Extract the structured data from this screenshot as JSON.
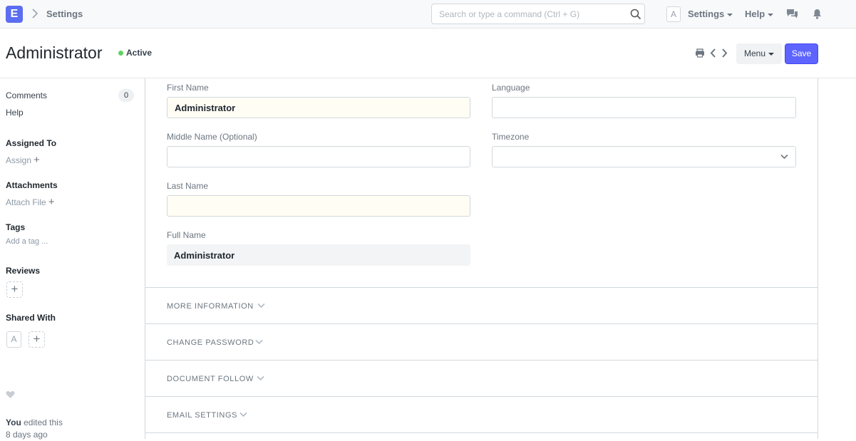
{
  "navbar": {
    "logo_letter": "E",
    "breadcrumb": "Settings",
    "search_placeholder": "Search or type a command (Ctrl + G)",
    "avatar_letter": "A",
    "settings_label": "Settings",
    "help_label": "Help"
  },
  "header": {
    "title": "Administrator",
    "status": "Active",
    "menu_label": "Menu",
    "save_label": "Save"
  },
  "sidebar": {
    "comments_label": "Comments",
    "comments_count": "0",
    "help_label": "Help",
    "assigned_to_label": "Assigned To",
    "assign_label": "Assign",
    "attachments_label": "Attachments",
    "attach_file_label": "Attach File",
    "tags_label": "Tags",
    "add_tag_label": "Add a tag ...",
    "reviews_label": "Reviews",
    "shared_with_label": "Shared With",
    "shared_avatar_letter": "A",
    "edited_by": "You",
    "edited_text": "edited this",
    "edited_when": "8 days ago"
  },
  "form": {
    "first_name_label": "First Name",
    "first_name_value": "Administrator",
    "middle_name_label": "Middle Name (Optional)",
    "middle_name_value": "",
    "last_name_label": "Last Name",
    "last_name_value": "",
    "full_name_label": "Full Name",
    "full_name_value": "Administrator",
    "language_label": "Language",
    "language_value": "",
    "timezone_label": "Timezone",
    "timezone_value": ""
  },
  "sections": [
    "MORE INFORMATION",
    "CHANGE PASSWORD",
    "DOCUMENT FOLLOW",
    "EMAIL SETTINGS"
  ],
  "colors": {
    "accent": "#5e64ff",
    "status_active": "#5fd35f",
    "logo": "#5b6df0"
  }
}
